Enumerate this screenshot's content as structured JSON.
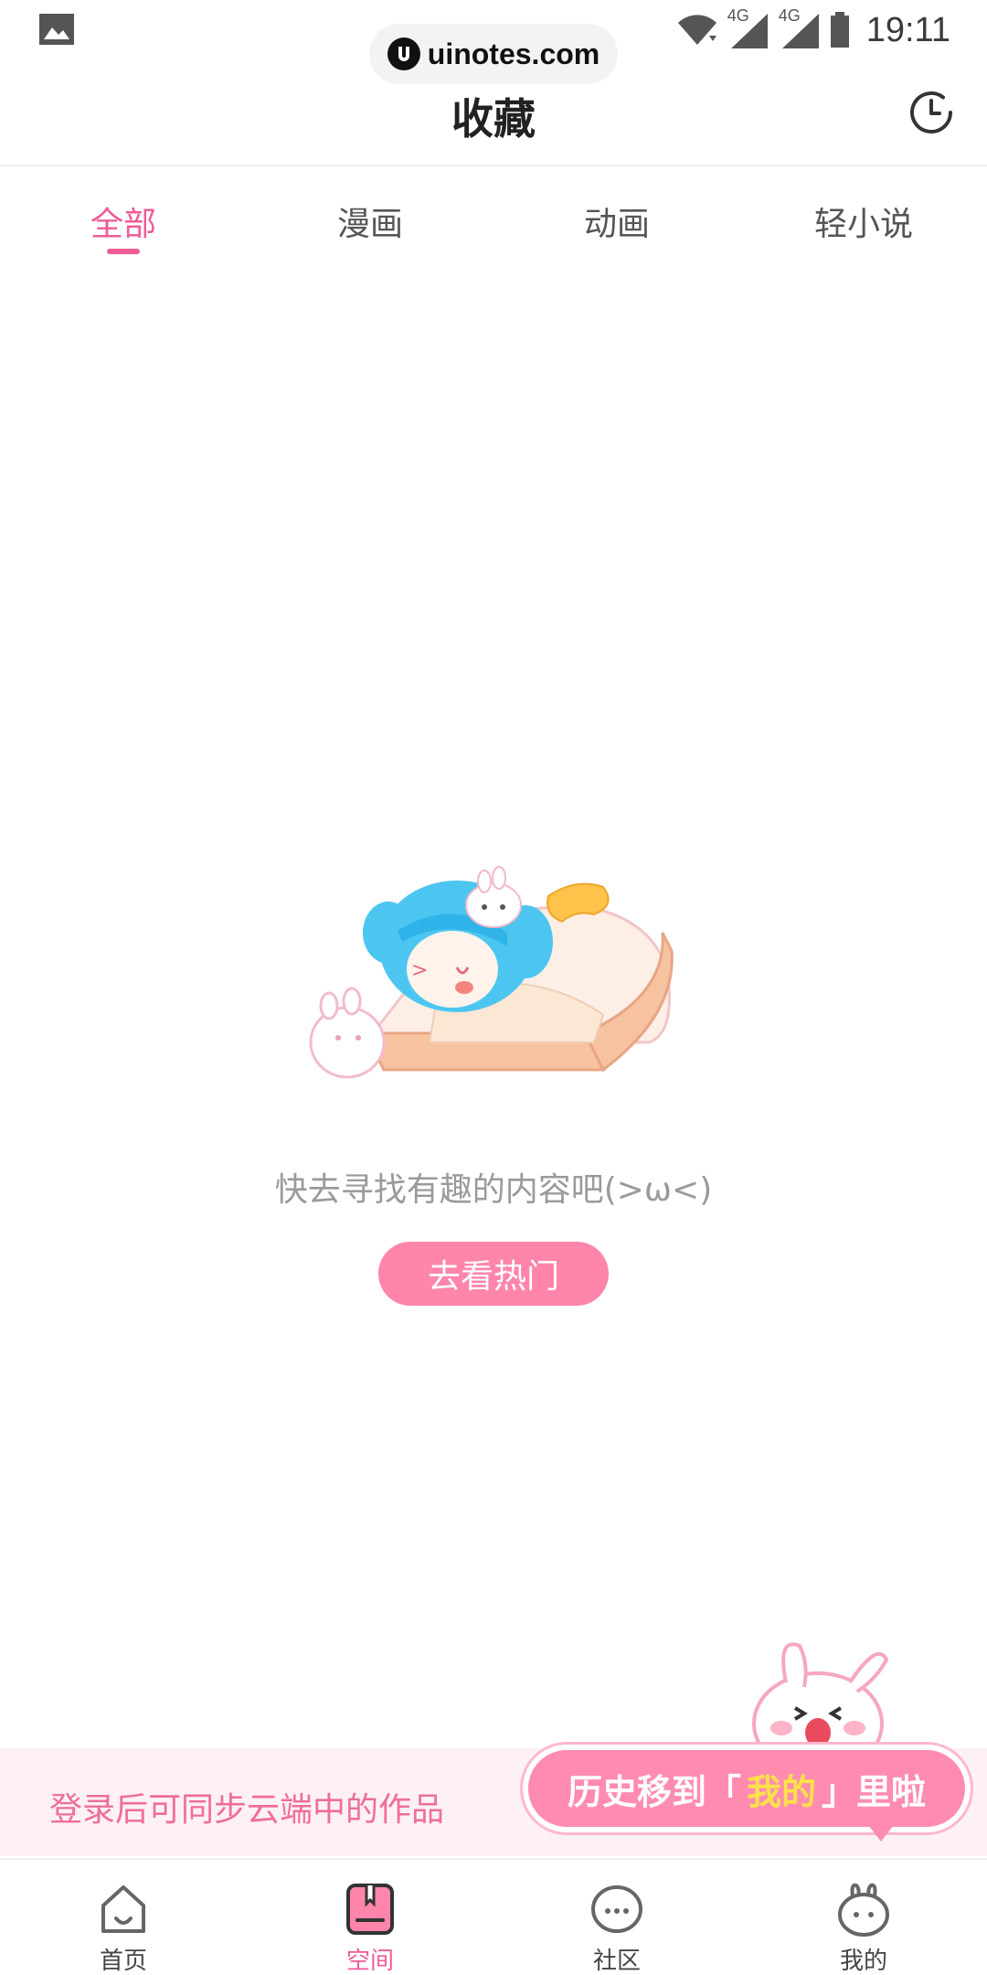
{
  "status_bar": {
    "time": "19:11",
    "network_1": "4G",
    "network_2": "4G",
    "icons": [
      "gallery-icon",
      "wifi-icon",
      "signal-icon",
      "battery-icon"
    ]
  },
  "watermark": {
    "text": "uinotes.com"
  },
  "header": {
    "title": "收藏",
    "history_icon": "clock-icon"
  },
  "tabs": [
    {
      "label": "全部",
      "active": true
    },
    {
      "label": "漫画",
      "active": false
    },
    {
      "label": "动画",
      "active": false
    },
    {
      "label": "轻小说",
      "active": false
    }
  ],
  "empty_state": {
    "message": "快去寻找有趣的内容吧(>ω<)",
    "button_label": "去看热门"
  },
  "login_banner": {
    "text": "登录后可同步云端中的作品"
  },
  "history_tip": {
    "prefix": "历史移到",
    "open_bracket": "「",
    "highlight": "我的",
    "close_bracket": "」",
    "suffix": "里啦"
  },
  "bottom_nav": [
    {
      "label": "首页",
      "icon": "home-icon",
      "active": false
    },
    {
      "label": "空间",
      "icon": "bookmark-icon",
      "active": true
    },
    {
      "label": "社区",
      "icon": "chat-icon",
      "active": false
    },
    {
      "label": "我的",
      "icon": "bunny-icon",
      "active": false
    }
  ],
  "colors": {
    "accent": "#ef5b97",
    "button": "#ff85ab",
    "banner_bg": "#fdf1f4",
    "tip_bubble": "#ff8cb0",
    "tip_highlight": "#ffe24a"
  }
}
